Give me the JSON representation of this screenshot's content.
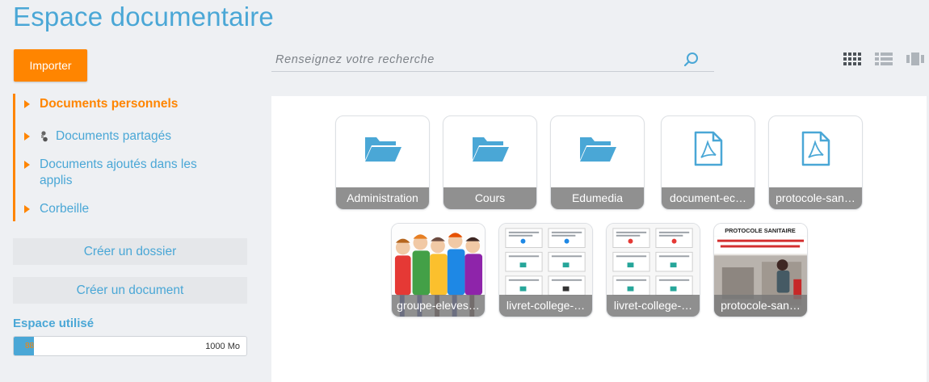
{
  "page": {
    "title": "Espace documentaire"
  },
  "toolbar": {
    "import_label": "Importer"
  },
  "search": {
    "placeholder": "Renseignez votre recherche"
  },
  "tree": {
    "items": [
      {
        "label": "Documents personnels",
        "icon": ""
      },
      {
        "label": "Documents partagés",
        "icon": "share-icon"
      },
      {
        "label": "Documents ajoutés dans les applis",
        "icon": ""
      },
      {
        "label": "Corbeille",
        "icon": ""
      }
    ]
  },
  "sidebar": {
    "create_folder_label": "Créer un dossier",
    "create_document_label": "Créer un document"
  },
  "storage": {
    "label": "Espace utilisé",
    "used": "88",
    "total": "1000 Mo",
    "used_fraction": 0.088
  },
  "view_modes": [
    "grid-icon",
    "list-icon",
    "carousel-icon"
  ],
  "files": [
    {
      "name": "Administration",
      "type": "folder"
    },
    {
      "name": "Cours",
      "type": "folder"
    },
    {
      "name": "Edumedia",
      "type": "folder"
    },
    {
      "name": "document-ec…",
      "type": "pdf"
    },
    {
      "name": "protocole-san…",
      "type": "pdf"
    },
    {
      "name": "groupe-eleves…",
      "type": "image"
    },
    {
      "name": "livret-college-…",
      "type": "image"
    },
    {
      "name": "livret-college-…",
      "type": "image"
    },
    {
      "name": "protocole-san…",
      "type": "image"
    }
  ],
  "thumbnail_text": {
    "protocol_title": "PROTOCOLE SANITAIRE"
  },
  "colors": {
    "accent": "#4aa7d6",
    "orange": "#ff8500",
    "caption_bg": "#787878"
  }
}
